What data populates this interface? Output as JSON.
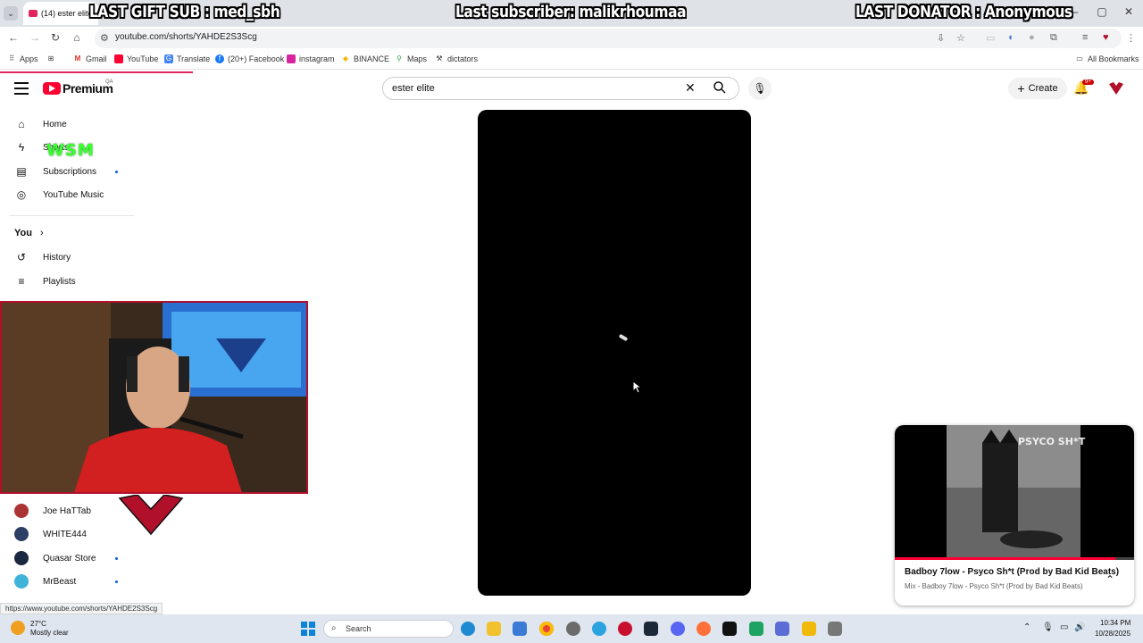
{
  "browser": {
    "tab_title": "(14) ester elite",
    "url": "youtube.com/shorts/YAHDE2S3Scg",
    "status_url": "https://www.youtube.com/shorts/YAHDE2S3Scg",
    "bookmarks": [
      "Apps",
      "Gmail",
      "YouTube",
      "Translate",
      "(20+) Facebook",
      "instagram",
      "BINANCE",
      "Maps",
      "dictators"
    ],
    "all_bookmarks": "All Bookmarks"
  },
  "overlay": {
    "gift": "LAST GIFT SUB : med_sbh",
    "subscriber": "Last subscriber: malikrhoumaa",
    "donator": "LAST DONATOR : Anonymous",
    "webcam_badge": "WSM"
  },
  "youtube": {
    "brand": "Premium",
    "brand_cc": "QA",
    "search_value": "ester elite",
    "create_label": "Create",
    "notif_count": "9+",
    "sidebar_top": [
      "Home",
      "Shorts",
      "Subscriptions",
      "YouTube Music"
    ],
    "you_label": "You",
    "sidebar_you": [
      "History",
      "Playlists"
    ],
    "channels": [
      "Joe HaTTab",
      "WHITE444",
      "Quasar Store",
      "MrBeast"
    ]
  },
  "mini_player": {
    "title": "Badboy 7low - Psyco Sh*t (Prod by Bad Kid Beats)",
    "subtitle": "Mix - Badboy 7low - Psyco Sh*t (Prod by Bad Kid Beats)",
    "thumb_caption": "PSYCO SH*T",
    "progress": 0.92
  },
  "taskbar": {
    "temperature": "27°C",
    "weather": "Mostly clear",
    "search_placeholder": "Search",
    "time": "10:34 PM",
    "date": "10/28/2025"
  },
  "colors": {
    "youtube_red": "#ff0033",
    "accent_pink": "#e0245e",
    "wsm_green": "#38ff2e"
  }
}
